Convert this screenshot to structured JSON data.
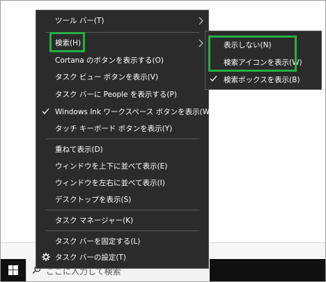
{
  "taskbar": {
    "search_placeholder": "ここに入力して検索"
  },
  "context_menu": {
    "items": [
      {
        "label": "ツール バー(T)"
      },
      {
        "label": "検索(H)"
      },
      {
        "label": "Cortana のボタンを表示する(O)"
      },
      {
        "label": "タスク ビュー ボタンを表示(V)"
      },
      {
        "label": "タスク バーに People を表示する(P)"
      },
      {
        "label": "Windows Ink ワークスペース ボタンを表示(W)"
      },
      {
        "label": "タッチ キーボード ボタンを表示(Y)"
      },
      {
        "label": "重ねて表示(D)"
      },
      {
        "label": "ウィンドウを上下に並べて表示(E)"
      },
      {
        "label": "ウィンドウを左右に並べて表示(I)"
      },
      {
        "label": "デスクトップを表示(S)"
      },
      {
        "label": "タスク マネージャー(K)"
      },
      {
        "label": "タスク バーを固定する(L)"
      },
      {
        "label": "タスク バーの設定(T)"
      }
    ]
  },
  "search_submenu": {
    "items": [
      {
        "label": "表示しない(N)"
      },
      {
        "label": "検索アイコンを表示(W)"
      },
      {
        "label": "検索ボックスを表示(B)"
      }
    ]
  },
  "colors": {
    "menu_background": "#2b2b2b",
    "highlight_border": "#27ae45",
    "taskbar": "#101010"
  }
}
